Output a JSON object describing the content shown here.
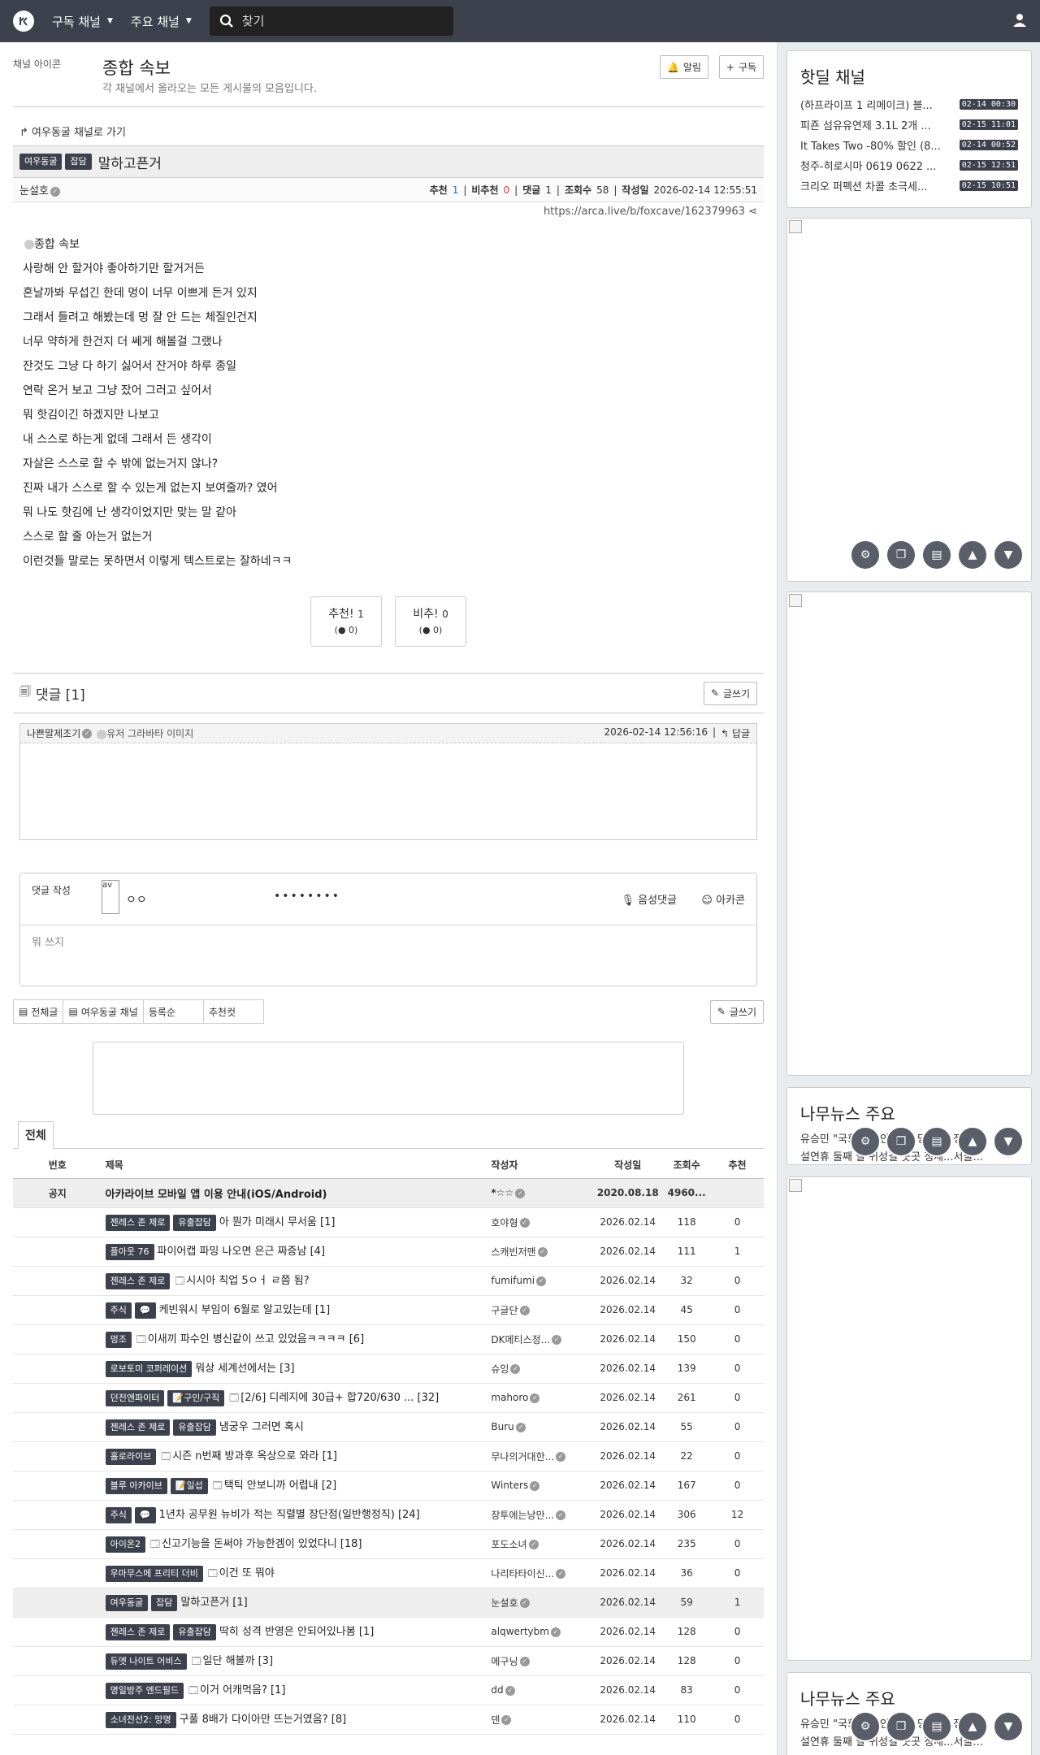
{
  "navbar": {
    "logo": "【",
    "menu1": "구독 채널",
    "menu2": "주요 채널",
    "search_placeholder": "찾기"
  },
  "board": {
    "icon_alt": "채널 아이콘",
    "title": "종합 속보",
    "desc": "각 채널에서 올라오는 모든 게시물의 모음입니다.",
    "alarm": "알림",
    "subscribe": "구독"
  },
  "article": {
    "back_link": "여우동굴 채널로 가기",
    "channel_badge": "여우동굴",
    "category_badge": "잡담",
    "title": "말하고픈거",
    "author": "눈설호",
    "rec_label": "추천",
    "rec": "1",
    "unrec_label": "비추천",
    "unrec": "0",
    "comments_label": "댓글",
    "comments": "1",
    "views_label": "조회수",
    "views": "58",
    "date_label": "작성일",
    "date": "2026-02-14 12:55:51",
    "url": "https://arca.live/b/foxcave/162379963",
    "image_alt": "종합 속보",
    "body": [
      "사랑해 안 할거야 좋아하기만 할거거든",
      "혼날까봐 무섭긴 한데 멍이 너무 이쁘게 든거 있지",
      "그래서 들려고 해봤는데 멍 잘 안 드는 체질인건지",
      "너무 약하게 한건지 더 쎄게 해볼걸 그랬나",
      "잔것도 그냥 다 하기 싫어서 잔거야 하루 종일",
      "연락 온거 보고 그냥 잤어 그러고 싶어서",
      "뭐 핫김이긴 하겠지만 나보고",
      "내 스스로 하는게 없데 그래서 든 생각이",
      "자살은 스스로 할 수 밖에 없는거지 않나?",
      "진짜 내가 스스로 할 수 있는게 없는지 보여줄까? 였어",
      "뭐 나도 핫김에 난 생각이었지만 맞는 말 같아",
      "스스로 할 줄 아는거 없는거",
      "이런것들 말로는 못하면서 이렇게 텍스트로는 잘하네ㅋㅋ"
    ],
    "vote_up": "추천!",
    "vote_up_count": "1",
    "vote_up_sub": "0",
    "vote_down": "비추!",
    "vote_down_count": "0",
    "vote_down_sub": "0"
  },
  "comments": {
    "header": "댓글 [1]",
    "write_btn": "글쓰기",
    "items": [
      {
        "author": "나쁜말제조기",
        "avatar_alt": "유저 그라바타 이미지",
        "date": "2026-02-14 12:56:16",
        "reply": "답글"
      }
    ]
  },
  "comment_form": {
    "label": "댓글 작성",
    "avatar_alt": "av",
    "name": "ㅇㅇ",
    "password": "••••••••",
    "voice": "음성댓글",
    "arcacon": "아카콘",
    "placeholder": "뭐 쓰지"
  },
  "board_tabs": {
    "all": "전체글",
    "channel": "여우동굴 채널",
    "sort": "등록순",
    "rec_cut": "추천컷",
    "write": "글쓰기"
  },
  "list": {
    "tab": "전체",
    "headers": {
      "no": "번호",
      "title": "제목",
      "author": "작성자",
      "date": "작성일",
      "views": "조회수",
      "rec": "추천"
    },
    "notice": {
      "no": "공지",
      "title": "아카라이브 모바일 앱 이용 안내(iOS/Android)",
      "author": "*☆☆",
      "date": "2020.08.18",
      "views": "4960...",
      "rec": ""
    },
    "rows": [
      {
        "badges": [
          "젠레스 존 제로",
          "유출잡담"
        ],
        "icon": "",
        "title": "아 뭔가 미래시 무서움 [1]",
        "author": "호야형",
        "date": "2026.02.14",
        "views": "118",
        "rec": "0"
      },
      {
        "badges": [
          "플아웃 76"
        ],
        "icon": "",
        "title": "파이어캡 파밍 나오면 은근 짜증남 [4]",
        "author": "스캐빈저맨",
        "date": "2026.02.14",
        "views": "111",
        "rec": "1"
      },
      {
        "badges": [
          "젠레스 존 제로"
        ],
        "icon": "🗔",
        "title": "시시아 칙업 5ㅇㅓ ㄹ쯤 됨?",
        "author": "fumifumi",
        "date": "2026.02.14",
        "views": "32",
        "rec": "0"
      },
      {
        "badges": [
          "주식",
          "💬"
        ],
        "icon": "",
        "title": "케빈워시 부임이 6월로 알고있는데 [1]",
        "author": "구글단",
        "date": "2026.02.14",
        "views": "45",
        "rec": "0"
      },
      {
        "badges": [
          "멍조"
        ],
        "icon": "🗔",
        "title": "이새끼 파수인 병신같이 쓰고 있었음ㅋㅋㅋㅋ [6]",
        "author": "DK메티스정...",
        "date": "2026.02.14",
        "views": "150",
        "rec": "0"
      },
      {
        "badges": [
          "로보토미 코퍼레이션"
        ],
        "icon": "",
        "title": "뭐상 세계선에서는 [3]",
        "author": "슈잉",
        "date": "2026.02.14",
        "views": "139",
        "rec": "0"
      },
      {
        "badges": [
          "던전앤파이터",
          "📝구인/구직"
        ],
        "icon": "🗔",
        "title": "[2/6] 디레지에 30급+ 합720/630 ... [32]",
        "author": "mahoro",
        "date": "2026.02.14",
        "views": "261",
        "rec": "0"
      },
      {
        "badges": [
          "젠레스 존 제로",
          "유출잡담"
        ],
        "icon": "",
        "title": "냄궁우 그러면 혹시",
        "author": "Buru",
        "date": "2026.02.14",
        "views": "55",
        "rec": "0"
      },
      {
        "badges": [
          "홀로라이브"
        ],
        "icon": "🗔",
        "title": "시즌 n번째 방과후 옥상으로 와라 [1]",
        "author": "무나의거대한...",
        "date": "2026.02.14",
        "views": "22",
        "rec": "0"
      },
      {
        "badges": [
          "블루 아카이브",
          "📝일섭"
        ],
        "icon": "🗔",
        "title": "택틱 안보니까 어렵내 [2]",
        "author": "Winters",
        "date": "2026.02.14",
        "views": "167",
        "rec": "0"
      },
      {
        "badges": [
          "주식",
          "💬"
        ],
        "icon": "",
        "title": "1년차 공무원 뉴비가 적는 직렬별 장단점(일반행정직) [24]",
        "author": "장투에는낭만...",
        "date": "2026.02.14",
        "views": "306",
        "rec": "12"
      },
      {
        "badges": [
          "아이온2"
        ],
        "icon": "🗔",
        "title": "신고기능을 돈써야 가능한겜이 있었다니 [18]",
        "author": "포도소녀",
        "date": "2026.02.14",
        "views": "235",
        "rec": "0"
      },
      {
        "badges": [
          "우마무스메 프리티 더비"
        ],
        "icon": "🗔",
        "title": "이건 또 뭐야",
        "author": "나리타타이신...",
        "date": "2026.02.14",
        "views": "36",
        "rec": "0"
      },
      {
        "badges": [
          "여우동굴",
          "잡담"
        ],
        "icon": "",
        "title": "말하고픈거 [1]",
        "author": "눈설호",
        "date": "2026.02.14",
        "views": "59",
        "rec": "1",
        "current": true
      },
      {
        "badges": [
          "젠레스 존 제로",
          "유출잡담"
        ],
        "icon": "",
        "title": "딱히 성격 반영은 안되어있나봄 [1]",
        "author": "alqwertybm",
        "date": "2026.02.14",
        "views": "128",
        "rec": "0"
      },
      {
        "badges": [
          "듀엣 나이트 어비스"
        ],
        "icon": "🗔",
        "title": "일단 해볼까 [3]",
        "author": "메구닝",
        "date": "2026.02.14",
        "views": "128",
        "rec": "0"
      },
      {
        "badges": [
          "명일방주 엔드필드"
        ],
        "icon": "🗔",
        "title": "이거 어캐먹음? [1]",
        "author": "dd",
        "date": "2026.02.14",
        "views": "83",
        "rec": "0"
      },
      {
        "badges": [
          "소녀전선2: 망명"
        ],
        "icon": "",
        "title": "구풀 8배가 다이아만 뜨는거였음? [8]",
        "author": "덴",
        "date": "2026.02.14",
        "views": "110",
        "rec": "0"
      }
    ]
  },
  "sidebar": {
    "hotdeal_title": "핫딜 채널",
    "hotdeals": [
      {
        "title": "(하프라이프 1 리메이크) 블...",
        "date": "02-14 00:30"
      },
      {
        "title": "피죤 섬유유연제 3.1L 2개 ...",
        "date": "02-15 11:01"
      },
      {
        "title": "It Takes Two -80% 할인 (8...",
        "date": "02-14 00:52"
      },
      {
        "title": "청주-히로시마 0619 0622 ...",
        "date": "02-15 12:51"
      },
      {
        "title": "크리오 퍼펙션 차콜 초극세...",
        "date": "02-15 10:51"
      }
    ],
    "news_title": "나무뉴스 주요",
    "news": [
      "유승민 \"국회의원 안내\"로 당 나락 정세...",
      "설연휴 둘째 날 귀성길 곳곳 정체...서울..."
    ]
  }
}
